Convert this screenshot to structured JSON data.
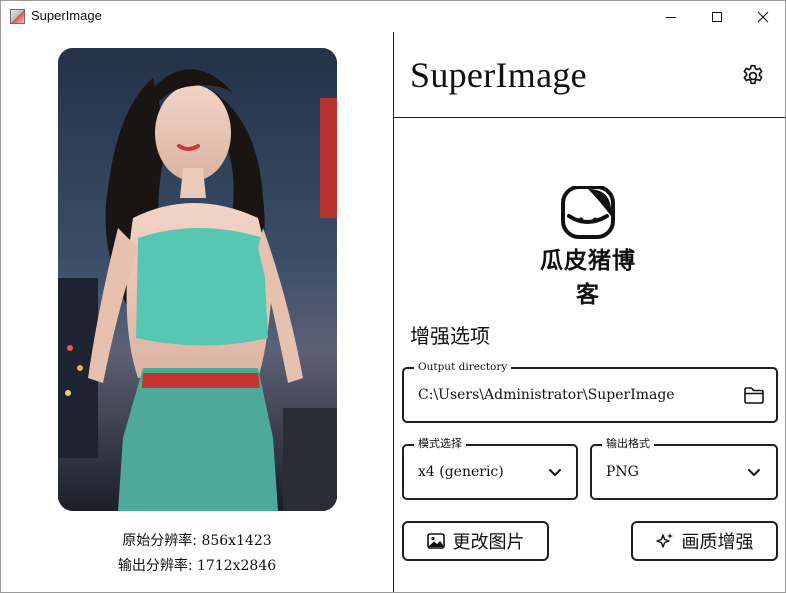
{
  "window": {
    "title": "SuperImage"
  },
  "left": {
    "original_label": "原始分辨率:",
    "original_value": "856x1423",
    "output_label": "输出分辨率:",
    "output_value": "1712x2846"
  },
  "right": {
    "app_title": "SuperImage",
    "logo_text": "瓜皮猪博客",
    "section_title": "增强选项",
    "output_dir": {
      "legend": "Output directory",
      "value": "C:\\Users\\Administrator\\SuperImage"
    },
    "mode": {
      "legend": "模式选择",
      "value": "x4 (generic)"
    },
    "format": {
      "legend": "输出格式",
      "value": "PNG"
    },
    "change_image_button": "更改图片",
    "enhance_button": "画质增强"
  },
  "colors": {
    "border": "#1e1e1e",
    "background": "#ffffff"
  }
}
